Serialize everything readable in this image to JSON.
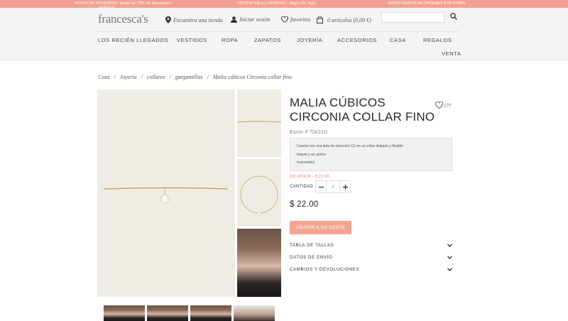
{
  "promo": {
    "left": "VENTA DE INVIERNO: hasta un 70% de descuento!",
    "left_sub": "SEMAINCHP",
    "center": "VENTAS DE LA SEMANA - haga clic aquí",
    "right": "ENVÍO GRATIS EN ÓRDENES $ 50 O MÁS"
  },
  "header": {
    "logo": "francesca's",
    "store_link": "Encuentra una tienda",
    "login_link": "Iniciar sesión",
    "favorites_link": "favoritos",
    "cart_link": "0 artículos (0,00 €)",
    "search_placeholder": ""
  },
  "nav": [
    "LOS RECIÉN LLEGADOS",
    "VESTIDOS",
    "ROPA",
    "ZAPATOS",
    "JOYERÍA",
    "ACCESORIOS",
    "CASA",
    "REGALOS",
    "VENTA"
  ],
  "breadcrumb": [
    "Casa",
    "Joyería",
    "collares",
    "gargantillas",
    "Malia cúbicos Circonia collar fino"
  ],
  "product": {
    "title": "MALIA CÚBICOS CIRCONIA COLLAR FINO",
    "favorites_count": "177",
    "style": "Estilo # 75631G",
    "description": [
      "- Cuenta con una bola de inserción CZ en un collar delgado y flexible",
      "- Níquel y sin plomo",
      "- Importados"
    ],
    "stock": "EN STOCK - $ 22.00",
    "quantity_label": "CANTIDAD",
    "quantity": "1",
    "price": "$ 22.00",
    "add_to_cart": "AÑADIR A SU CESTA",
    "accordion": [
      "TABLA DE TALLAS",
      "DATOS DE ENVÍO",
      "CAMBIOS Y DEVOLUCIONES"
    ]
  },
  "colors": {
    "accent": "#f3a591",
    "promo_bar": "#f3a08f",
    "stock": "#e0735e"
  }
}
